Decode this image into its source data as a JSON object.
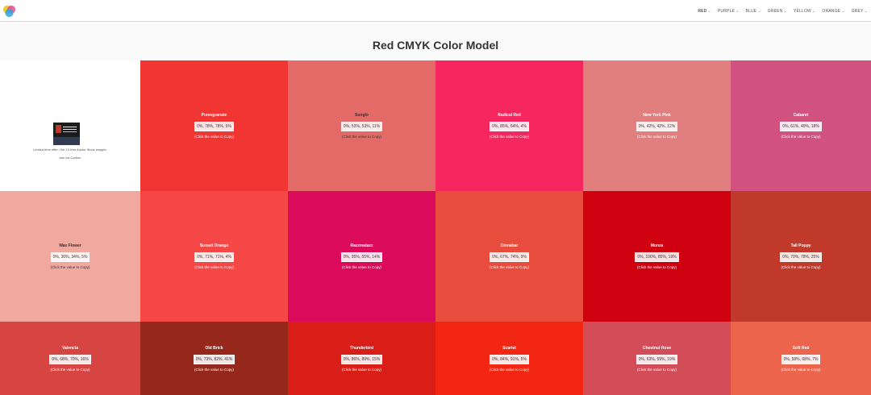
{
  "nav": {
    "items": [
      {
        "label": "RED",
        "active": true
      },
      {
        "label": "PURPLE",
        "active": false
      },
      {
        "label": "BLUE",
        "active": false
      },
      {
        "label": "GREEN",
        "active": false
      },
      {
        "label": "YELLOW",
        "active": false
      },
      {
        "label": "ORANGE",
        "active": false
      },
      {
        "label": "GREY",
        "active": false
      }
    ]
  },
  "page": {
    "title": "Red CMYK Color Model"
  },
  "ad": {
    "text": "Limited time offer: Get 10 free Adobe Stock images.",
    "link": "ads via Carbon"
  },
  "copy_hint": "(Click the value to Copy)",
  "colors": [
    {
      "name": "Pomegranate",
      "value": "0%, 78%, 78%, 6%",
      "bg": "#f03532",
      "fg": "#ffffff"
    },
    {
      "name": "Sunglo",
      "value": "0%, 53%, 53%, 11%",
      "bg": "#e36a66",
      "fg": "#333333"
    },
    {
      "name": "Radical Red",
      "value": "0%, 85%, 64%, 4%",
      "bg": "#f5275e",
      "fg": "#ffffff"
    },
    {
      "name": "New York Pink",
      "value": "0%, 42%, 42%, 12%",
      "bg": "#e07f7d",
      "fg": "#ffffff"
    },
    {
      "name": "Cabaret",
      "value": "0%, 61%, 40%, 18%",
      "bg": "#d2527f",
      "fg": "#ffffff"
    },
    {
      "name": "Wax Flower",
      "value": "0%, 30%, 34%, 5%",
      "bg": "#f1a99f",
      "fg": "#333333"
    },
    {
      "name": "Sunset Orange",
      "value": "0%, 71%, 71%, 4%",
      "bg": "#f64747",
      "fg": "#ffffff"
    },
    {
      "name": "Razzmatazz",
      "value": "0%, 95%, 55%, 14%",
      "bg": "#db0a5b",
      "fg": "#ffffff"
    },
    {
      "name": "Cinnabar",
      "value": "0%, 67%, 74%, 9%",
      "bg": "#e74c3c",
      "fg": "#ffffff"
    },
    {
      "name": "Monza",
      "value": "0%, 100%, 85%, 19%",
      "bg": "#cf000f",
      "fg": "#ffffff"
    },
    {
      "name": "Tall Poppy",
      "value": "0%, 70%, 78%, 25%",
      "bg": "#c0392b",
      "fg": "#ffffff"
    },
    {
      "name": "Valencia",
      "value": "0%, 68%, 70%, 16%",
      "bg": "#d64541",
      "fg": "#ffffff"
    },
    {
      "name": "Old Brick",
      "value": "0%, 73%, 82%, 41%",
      "bg": "#96281b",
      "fg": "#ffffff"
    },
    {
      "name": "Thunderbird",
      "value": "0%, 86%, 89%, 15%",
      "bg": "#d91e18",
      "fg": "#ffffff"
    },
    {
      "name": "Scarlet",
      "value": "0%, 84%, 91%, 5%",
      "bg": "#f22613",
      "fg": "#ffffff"
    },
    {
      "name": "Chestnut Rose",
      "value": "0%, 63%, 59%, 19%",
      "bg": "#d24d57",
      "fg": "#ffffff"
    },
    {
      "name": "Soft Red",
      "value": "0%, 58%, 68%, 7%",
      "bg": "#ec644b",
      "fg": "#ffffff"
    }
  ]
}
